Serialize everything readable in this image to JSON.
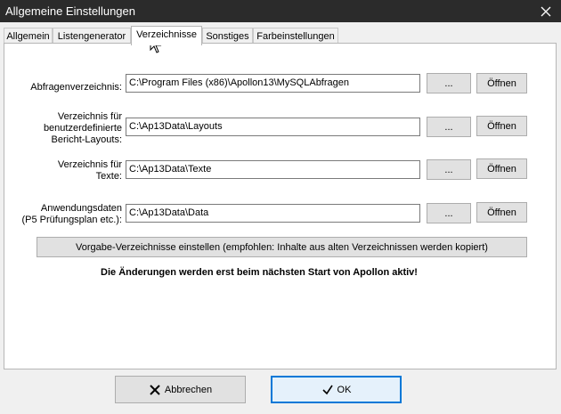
{
  "window": {
    "title": "Allgemeine Einstellungen"
  },
  "tabs": [
    {
      "label": "Allgemein"
    },
    {
      "label": "Listengenerator"
    },
    {
      "label": "Verzeichnisse",
      "active": true
    },
    {
      "label": "Sonstiges"
    },
    {
      "label": "Farbeinstellungen"
    }
  ],
  "rows": [
    {
      "label": "Abfragenverzeichnis:",
      "value": "C:\\Program Files (x86)\\Apollon13\\MySQLAbfragen",
      "browse": "...",
      "open": "Öffnen"
    },
    {
      "label": "Verzeichnis für\nbenutzerdefinierte\nBericht-Layouts:",
      "value": "C:\\Ap13Data\\Layouts",
      "browse": "...",
      "open": "Öffnen"
    },
    {
      "label": "Verzeichnis für\nTexte:",
      "value": "C:\\Ap13Data\\Texte",
      "browse": "...",
      "open": "Öffnen"
    },
    {
      "label": "Anwendungsdaten\n(P5 Prüfungsplan etc.):",
      "value": "C:\\Ap13Data\\Data",
      "browse": "...",
      "open": "Öffnen"
    }
  ],
  "defaults_button": "Vorgabe-Verzeichnisse einstellen (empfohlen: Inhalte aus alten Verzeichnissen werden kopiert)",
  "notice": "Die Änderungen werden erst beim nächsten Start von Apollon aktiv!",
  "footer": {
    "cancel": "Abbrechen",
    "ok": "OK"
  },
  "icons": {
    "close": "close-icon",
    "cancel": "x-icon",
    "ok": "check-icon",
    "cursor": "mouse-pointer-icon"
  }
}
